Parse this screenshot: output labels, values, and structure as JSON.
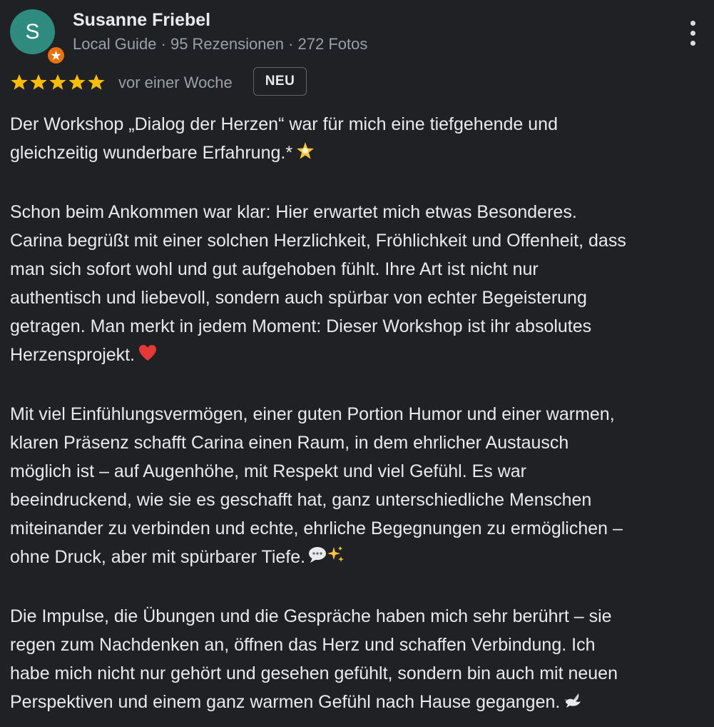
{
  "review": {
    "author": {
      "avatar_letter": "S",
      "avatar_color": "#2e8b7d",
      "badge_icon": "local-guide-badge-icon",
      "name": "Susanne Friebel",
      "meta": "Local Guide · 95 Rezensionen · 272 Fotos"
    },
    "menu_icon": "more-vertical-icon",
    "rating": {
      "stars": 5,
      "max": 5,
      "star_color": "#fbbc04"
    },
    "time_ago": "vor einer Woche",
    "badge": "NEU",
    "paragraphs": [
      {
        "text": "Der Workshop „Dialog der Herzen“ war für mich eine tiefgehende und\ngleichzeitig wunderbare Erfahrung.*",
        "emoji": "glowing-star-emoji"
      },
      {
        "text": "Schon beim Ankommen war klar: Hier erwartet mich etwas Besonderes.\nCarina begrüßt mit einer solchen Herzlichkeit, Fröhlichkeit und Offenheit, dass\nman sich sofort wohl und gut aufgehoben fühlt. Ihre Art ist nicht nur\nauthentisch und liebevoll, sondern auch spürbar von echter Begeisterung\ngetragen. Man merkt in jedem Moment: Dieser Workshop ist ihr absolutes\nHerzensprojekt.",
        "emoji": "red-heart-emoji"
      },
      {
        "text": "Mit viel Einfühlungsvermögen, einer guten Portion Humor und einer warmen,\nklaren Präsenz schafft Carina einen Raum, in dem ehrlicher Austausch\nmöglich ist – auf Augenhöhe, mit Respekt und viel Gefühl. Es war\nbeeindruckend, wie sie es geschafft hat, ganz unterschiedliche Menschen\nmiteinander zu verbinden und echte, ehrliche Begegnungen zu ermöglichen –\nohne Druck, aber mit spürbarer Tiefe.",
        "emoji": "speech-bubble-sparkles-emoji"
      },
      {
        "text": "Die Impulse, die Übungen und die Gespräche haben mich sehr berührt – sie\nregen zum Nachdenken an, öffnen das Herz und schaffen Verbindung. Ich\nhabe mich nicht nur gehört und gesehen gefühlt, sondern bin auch mit neuen\nPerspektiven und einem ganz warmen Gefühl nach Hause gegangen.",
        "emoji": "dove-emoji"
      }
    ]
  }
}
